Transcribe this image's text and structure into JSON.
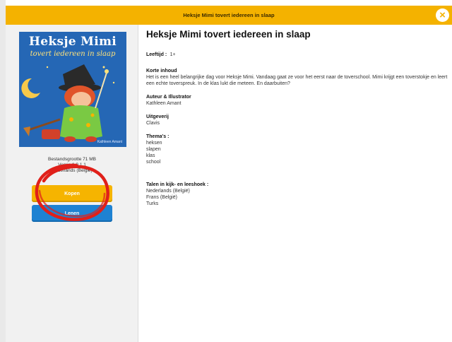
{
  "header": {
    "title": "Heksje Mimi tovert iedereen in slaap"
  },
  "sidebar": {
    "cover": {
      "title": "Heksje Mimi",
      "subtitle": "tovert iedereen in slaap",
      "author": "Kathleen Amant"
    },
    "file_meta": {
      "size": "Bestandsgrootte 71 MB",
      "version": "Versie 1.0.1.1",
      "language": "Nederlands (België)"
    },
    "primary_button_label": "Kopen",
    "secondary_button_label": "Lenen"
  },
  "detail": {
    "title": "Heksje Mimi tovert iedereen in slaap",
    "age": {
      "label": "Leeftijd :",
      "value": "1+"
    },
    "summary": {
      "label": "Korte inhoud",
      "text": "Het is een heel belangrijke dag voor Heksje Mimi. Vandaag gaat ze voor het eerst naar de toverschool. Mimi krijgt een toverstokje en leert een echte toverspreuk. In de klas lukt die meteen. En daarbuiten?"
    },
    "author": {
      "label": "Auteur & Illustrator",
      "value": "Kathleen Amant"
    },
    "publisher": {
      "label": "Uitgeverij",
      "value": "Clavis"
    },
    "themes": {
      "label": "Thema's :",
      "items": [
        "heksen",
        "slapen",
        "klas",
        "school"
      ]
    },
    "languages": {
      "label": "Talen in kijk- en leeshoek :",
      "items": [
        "Nederlands (België)",
        "Frans (België)",
        "Turks"
      ]
    }
  },
  "colors": {
    "header_bar": "#f4b200",
    "primary_button": "#f6b400",
    "secondary_button": "#1e82d2",
    "annotation_circle": "#e0201a"
  },
  "icons": {
    "close": "close-icon"
  }
}
